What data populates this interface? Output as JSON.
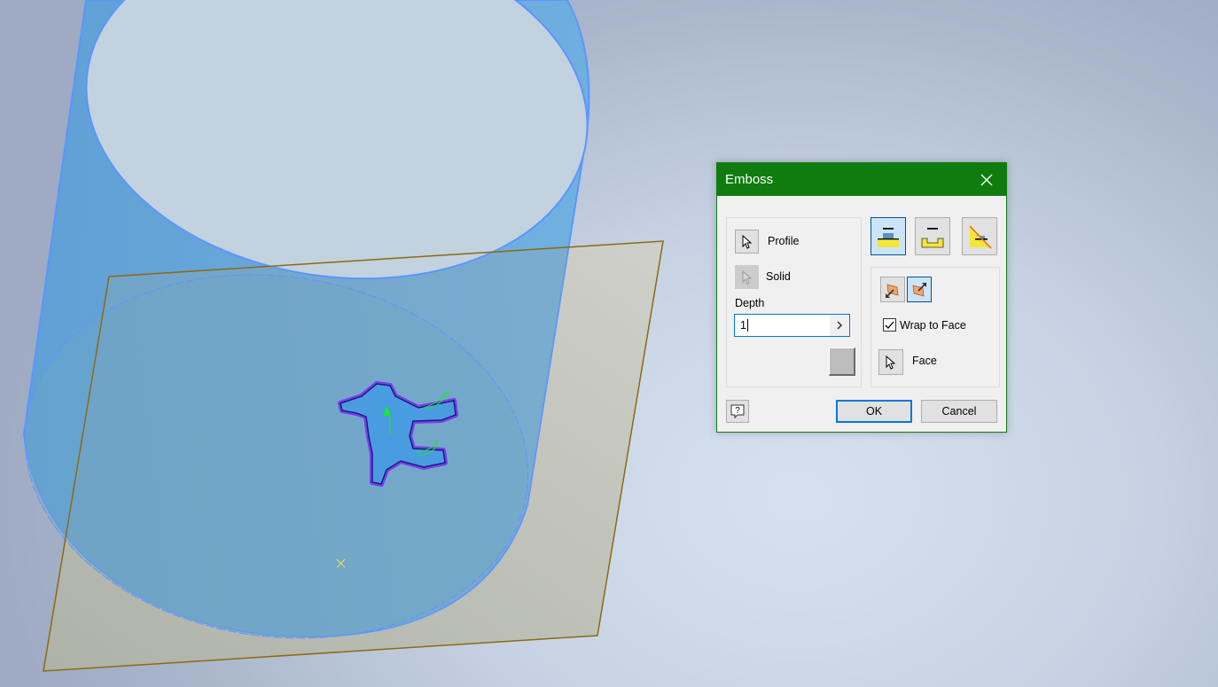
{
  "viewport": {
    "name": "3D graphics window",
    "objects": [
      "cylinder-body",
      "work-plane",
      "sketch-profile-horse",
      "sketch-origin-marker"
    ],
    "colors": {
      "cylinder_fill": "#5aa0d8",
      "cylinder_edge": "#5b96ff",
      "plane_fill": "#c8c9c0",
      "plane_edge": "#8b6a14",
      "profile_highlight": "#7b2cf0",
      "profile_green": "#19e83a",
      "origin_marker": "#e6e84a"
    }
  },
  "dialog": {
    "title": "Emboss",
    "close_icon": "close-icon",
    "accent_color": "#107c10",
    "profile_label": "Profile",
    "solid_label": "Solid",
    "depth_label": "Depth",
    "depth_value": "1",
    "mode_buttons": [
      {
        "name": "emboss-from-face",
        "active": true
      },
      {
        "name": "engrave-from-face",
        "active": false
      },
      {
        "name": "emboss-engrave-from-plane",
        "active": false
      }
    ],
    "direction_buttons": [
      {
        "name": "direction-1",
        "active": false
      },
      {
        "name": "direction-2",
        "active": true
      }
    ],
    "wrap_to_face_label": "Wrap to Face",
    "wrap_to_face_checked": true,
    "face_label": "Face",
    "ok_label": "OK",
    "cancel_label": "Cancel",
    "help_icon": "help-icon"
  }
}
